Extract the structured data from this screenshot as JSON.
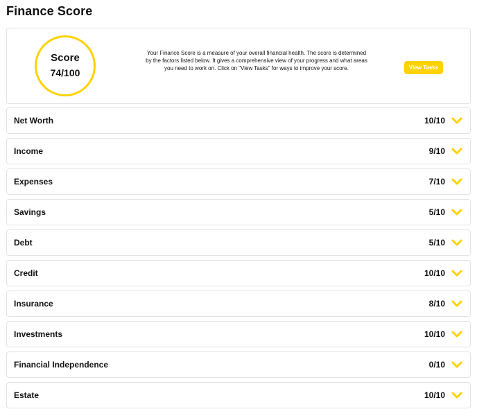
{
  "header": {
    "title": "Finance Score"
  },
  "score": {
    "label": "Score",
    "value": "74/100",
    "description": "Your Finance Score is a measure of your overall financial health. The score is determined by the factors listed below. It gives a comprehensive view of your progress and what areas you need to work on. Click on \"View Tasks\" for ways to improve your score.",
    "button_label": "View Tasks"
  },
  "factors": [
    {
      "name": "Net Worth",
      "score": "10/10"
    },
    {
      "name": "Income",
      "score": "9/10"
    },
    {
      "name": "Expenses",
      "score": "7/10"
    },
    {
      "name": "Savings",
      "score": "5/10"
    },
    {
      "name": "Debt",
      "score": "5/10"
    },
    {
      "name": "Credit",
      "score": "10/10"
    },
    {
      "name": "Insurance",
      "score": "8/10"
    },
    {
      "name": "Investments",
      "score": "10/10"
    },
    {
      "name": "Financial Independence",
      "score": "0/10"
    },
    {
      "name": "Estate",
      "score": "10/10"
    }
  ],
  "icons": {
    "expand": "chevron-down-icon"
  },
  "colors": {
    "accent": "#ffd200",
    "border": "#e3e3e3",
    "text": "#111111"
  }
}
